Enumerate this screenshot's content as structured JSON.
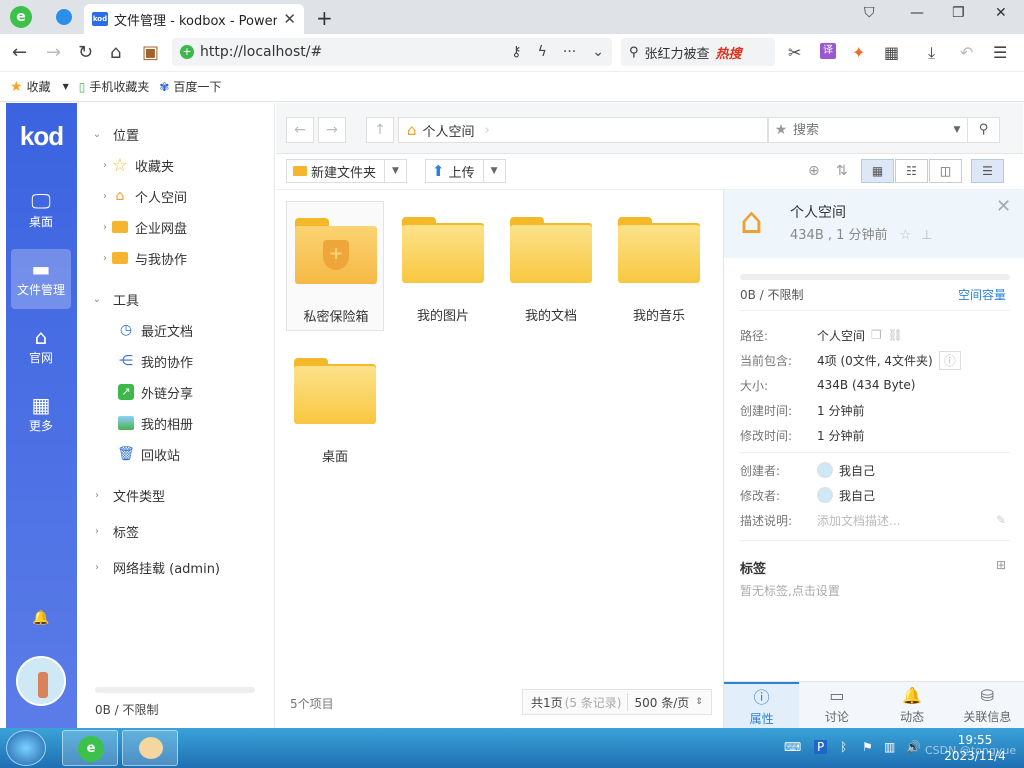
{
  "browser": {
    "tab_title": "文件管理 - kodbox - Powere",
    "tab_favicon": "kod",
    "address": "http://localhost/#",
    "search_text": "张红力被查",
    "search_hot": "热搜",
    "bookmarks": [
      {
        "label": "收藏",
        "icon": "star-icon"
      },
      {
        "label": "手机收藏夹",
        "icon": "phone-icon"
      },
      {
        "label": "百度一下",
        "icon": "baidu-icon"
      }
    ]
  },
  "leftbar": {
    "logo": "kod",
    "items": [
      {
        "label": "桌面",
        "icon": "desktop-icon"
      },
      {
        "label": "文件管理",
        "icon": "folder-icon"
      },
      {
        "label": "官网",
        "icon": "home-icon"
      },
      {
        "label": "更多",
        "icon": "grid-icon"
      }
    ]
  },
  "tree": {
    "location": "位置",
    "favorites": "收藏夹",
    "personal": "个人空间",
    "enterprise": "企业网盘",
    "shared": "与我协作",
    "tools": "工具",
    "recent": "最近文档",
    "mycollab": "我的协作",
    "links": "外链分享",
    "album": "我的相册",
    "recycle": "回收站",
    "filetypes": "文件类型",
    "tags": "标签",
    "mount": "网络挂载 (admin)",
    "quota": "0B / 不限制"
  },
  "path": {
    "crumb": "个人空间",
    "search_placeholder": "搜索"
  },
  "actions": {
    "new_folder": "新建文件夹",
    "upload": "上传"
  },
  "files": [
    {
      "name": "私密保险箱",
      "type": "safe"
    },
    {
      "name": "我的图片",
      "type": "folder"
    },
    {
      "name": "我的文档",
      "type": "folder"
    },
    {
      "name": "我的音乐",
      "type": "folder"
    },
    {
      "name": "桌面",
      "type": "folder"
    }
  ],
  "status": {
    "count": "5个项目",
    "pages": "共1页",
    "records": "(5 条记录)",
    "per_page": "500 条/页"
  },
  "props": {
    "title": "个人空间",
    "subtitle": "434B , 1 分钟前",
    "quota": "0B / 不限制",
    "quota_link": "空间容量",
    "rows": [
      {
        "k": "路径:",
        "v": "个人空间"
      },
      {
        "k": "当前包含:",
        "v": "4项 (0文件, 4文件夹)"
      },
      {
        "k": "大小:",
        "v": "434B (434 Byte)"
      },
      {
        "k": "创建时间:",
        "v": "1 分钟前"
      },
      {
        "k": "修改时间:",
        "v": "1 分钟前"
      },
      {
        "k": "创建者:",
        "v": "我自己"
      },
      {
        "k": "修改者:",
        "v": "我自己"
      },
      {
        "k": "描述说明:",
        "v": "添加文档描述..."
      }
    ],
    "tags_title": "标签",
    "tags_empty": "暂无标签,点击设置",
    "tabs": [
      {
        "label": "属性",
        "icon": "info-icon"
      },
      {
        "label": "讨论",
        "icon": "chat-icon"
      },
      {
        "label": "动态",
        "icon": "bell-icon"
      },
      {
        "label": "关联信息",
        "icon": "database-icon"
      }
    ]
  },
  "taskbar": {
    "time": "19:55",
    "date": "2023/11/4",
    "watermark": "CSDN @tongyue"
  }
}
